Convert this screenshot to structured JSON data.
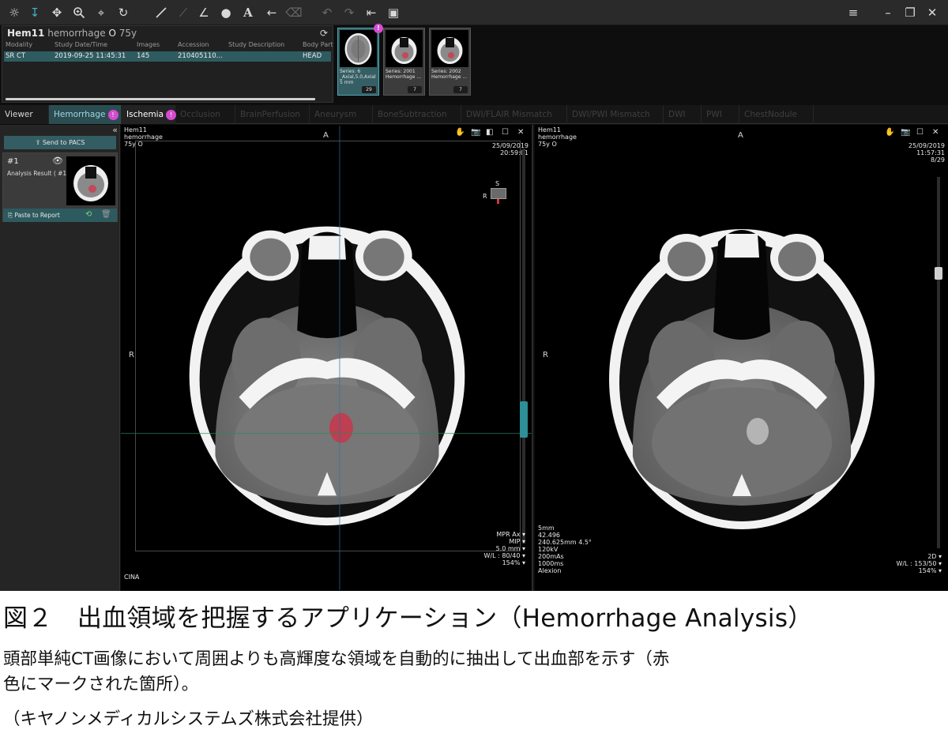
{
  "study": {
    "patient_id": "Hem11",
    "patient_name": "hemorrhage",
    "sex_symbol": "O",
    "age": "75y",
    "columns": [
      "Modality",
      "Study Date/Time",
      "Images",
      "Accession",
      "Study Description",
      "Body Part"
    ],
    "row": [
      "SR CT",
      "2019-09-25 11:45:31",
      "145",
      "210405110...",
      "",
      "HEAD"
    ],
    "progress": 0.93
  },
  "series": [
    {
      "label": "Series: 6\n_Axial,5.0,Axial\n5 mm",
      "count": "29",
      "selected": true
    },
    {
      "label": "Series: 2001\nHemorrhage ...",
      "count": "7",
      "selected": false
    },
    {
      "label": "Series: 2002\nHemorrhage ...",
      "count": "7",
      "selected": false
    }
  ],
  "tabs": {
    "viewer": "Viewer",
    "hemorrhage": "Hemorrhage",
    "ischemia": "Ischemia",
    "occlusion": "Occlusion",
    "brainperfusion": "BrainPerfusion",
    "aneurysm": "Aneurysm",
    "bonesubtraction": "BoneSubtraction",
    "dwiflair": "DWI/FLAIR Mismatch",
    "dwipwi": "DWI/PWI Mismatch",
    "dwi": "DWI",
    "pwi": "PWI",
    "chestnodule": "ChestNodule"
  },
  "left_panel": {
    "send_pacs": "Send to PACS",
    "result_num": "#1",
    "result_label": "Analysis Result ( #1 )",
    "paste_report": "Paste to Report"
  },
  "viewport1": {
    "top_left": "Hem11\nhemorrhage\n75y O",
    "top_right": "25/09/2019\n20:59:01",
    "orient_top": "A",
    "orient_left": "R",
    "bottom_right": "MPR Ax ▾\nMIP ▾\n5.0 mm ▾\nW/L : 80/40 ▾\n154% ▾",
    "bottom_left": "CINA",
    "orient_cube_top": "S",
    "orient_cube_left": "R"
  },
  "viewport2": {
    "top_left": "Hem11\nhemorrhage\n75y O",
    "top_right": "25/09/2019\n11:57:31\n8/29",
    "orient_top": "A",
    "orient_left": "R",
    "bottom_left": "5mm\n42.496\n240.625mm 4.5°\n120kV\n200mAs\n1000ms\nAlexion",
    "bottom_right": "2D ▾\nW/L : 153/50 ▾\n154% ▾"
  },
  "caption": {
    "title": "図２　出血領域を把握するアプリケーション（Hemorrhage Analysis）",
    "desc_line1": "頭部単純CT画像において周囲よりも高輝度な領域を自動的に抽出して出血部を示す（赤",
    "desc_line2": "色にマークされた箇所）。",
    "credit": "（キヤノンメディカルシステムズ株式会社提供）"
  },
  "colors": {
    "accent": "#3fb3c7",
    "selected_row": "#2e5b60",
    "badge": "#d64bd0",
    "hemorrhage_marker": "#c8364a"
  }
}
